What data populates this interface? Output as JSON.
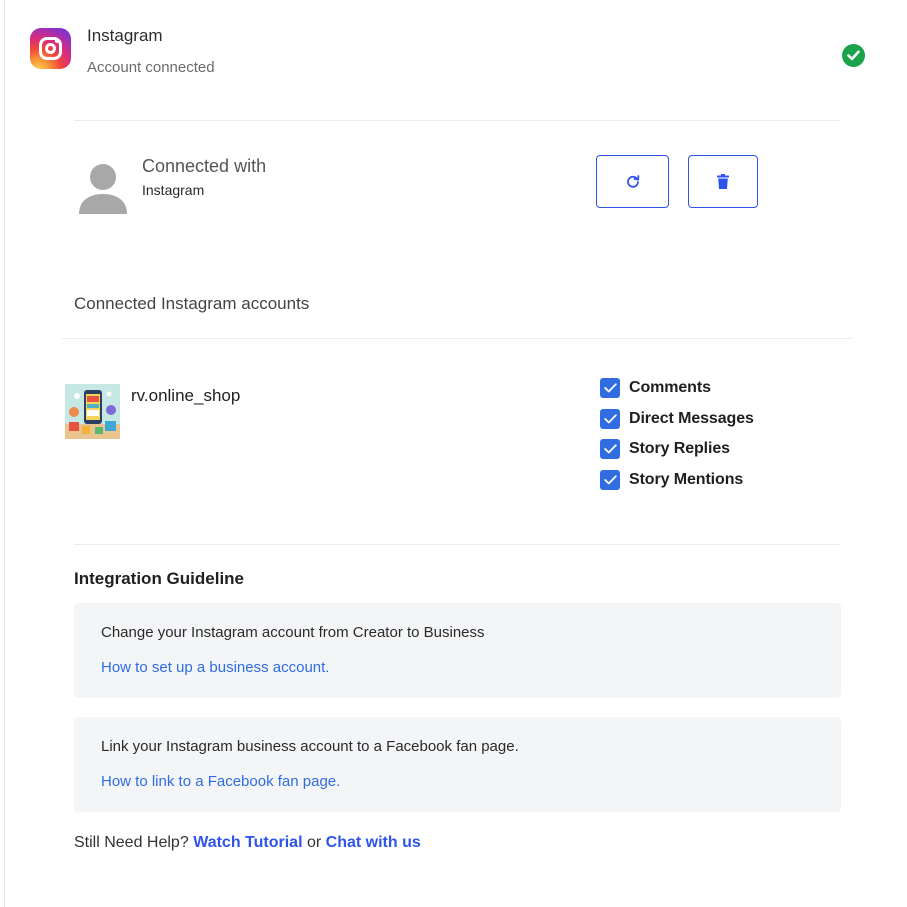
{
  "header": {
    "title": "Instagram",
    "status": "Account connected",
    "logo_icon": "instagram-logo",
    "status_icon": "check-circle-icon",
    "status_color": "#1aa34a"
  },
  "connection": {
    "title": "Connected with",
    "platform": "Instagram",
    "refresh_icon": "refresh-icon",
    "delete_icon": "trash-icon",
    "accent_color": "#2f54eb"
  },
  "accounts_section": {
    "title": "Connected Instagram accounts",
    "accounts": [
      {
        "name": "rv.online_shop",
        "permissions": [
          {
            "label": "Comments",
            "checked": true
          },
          {
            "label": "Direct Messages",
            "checked": true
          },
          {
            "label": "Story Replies",
            "checked": true
          },
          {
            "label": "Story Mentions",
            "checked": true
          }
        ]
      }
    ]
  },
  "guideline": {
    "title": "Integration Guideline",
    "cards": [
      {
        "text": "Change your Instagram account from Creator to Business",
        "link": "How to set up a business account."
      },
      {
        "text": "Link your Instagram business account to a Facebook fan page.",
        "link": "How to link to a Facebook fan page."
      }
    ]
  },
  "help": {
    "prefix": "Still Need Help?",
    "tutorial_link": "Watch Tutorial",
    "conjunction": "or",
    "chat_link": "Chat with us"
  }
}
